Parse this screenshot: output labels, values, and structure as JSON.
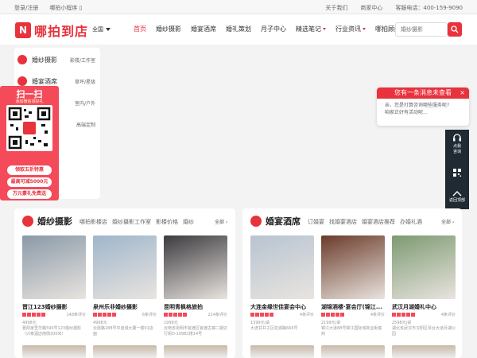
{
  "topbar": {
    "login": "登录/注册",
    "mini_program": "哪拍小程序",
    "about": "关于我们",
    "merchant": "商家中心",
    "phone": "客服电话：400-159-9090"
  },
  "header": {
    "logo_text": "哪拍到店",
    "city": "全国",
    "nav": [
      {
        "label": "首页",
        "active": true,
        "caret": false
      },
      {
        "label": "婚纱摄影",
        "active": false,
        "caret": false
      },
      {
        "label": "婚宴酒席",
        "active": false,
        "caret": false
      },
      {
        "label": "婚礼策划",
        "active": false,
        "caret": false
      },
      {
        "label": "月子中心",
        "active": false,
        "caret": false
      },
      {
        "label": "精选笔记",
        "active": false,
        "caret": true
      },
      {
        "label": "行业资讯",
        "active": false,
        "caret": true
      },
      {
        "label": "哪拍顾问",
        "active": false,
        "caret": false
      }
    ],
    "search_placeholder": "婚纱摄影"
  },
  "categories": [
    {
      "name": "婚纱摄影",
      "sub": "影楼/工作室"
    },
    {
      "name": "婚宴酒席",
      "sub": "草坪/星级"
    },
    {
      "name": "",
      "sub": "室内/户外"
    },
    {
      "name": "",
      "sub": "高端定制"
    }
  ],
  "qr_panel": {
    "title": "扫一扫",
    "subtitle": "添加微信领好礼",
    "center": "哪拍",
    "pills": [
      "领取五折特惠",
      "最高可减5000元",
      "万元豪礼免费送"
    ]
  },
  "chat": {
    "title": "您有一条消息未查看",
    "close": "×",
    "body_line1": "亲，您是打算咨询哪些服务呢?",
    "body_line2": "咱家正好有活动呢..."
  },
  "sidebar": {
    "consult_line1": "点我",
    "consult_line2": "咨询",
    "back_top": "返回顶部"
  },
  "wedding_photo": {
    "title": "婚纱摄影",
    "tags": [
      "哪拍影楼店",
      "婚纱摄影工作室",
      "影楼价格",
      "婚纱"
    ],
    "more": "全部",
    "cards": [
      {
        "name": "晋江123婚纱摄影",
        "reviews": "148条评价",
        "price": "4998元",
        "address": "晋阳家里华路590号123婚纱摄影（兴泰酒店南侧200米）",
        "color": "#8a9aa8"
      },
      {
        "name": "泉州乐非婚纱摄影",
        "reviews": "6条评价",
        "price": "4998元",
        "address": "云鼎路188号中迪城大厦一楼01店面",
        "color": "#9fb6cc"
      },
      {
        "name": "昆明青枫格旅拍",
        "reviews": "224条评价",
        "price": "1999元",
        "address": "云南省昆明市官渡区官渡古镇二期达行街D-109B1楼14号",
        "color": "#3c3a3f"
      }
    ]
  },
  "banquet": {
    "title": "婚宴酒席",
    "tags": [
      "订婚宴",
      "找婚宴酒店",
      "婚宴酒店推荐",
      "办婚礼酒"
    ],
    "more": "全部",
    "cards": [
      {
        "name": "大连金缘世佳宴会中心",
        "reviews": "4条评价",
        "price": "1399元/桌",
        "address": "大连甘井子区虹城路666号",
        "color": "#b7c4d1"
      },
      {
        "name": "湖锦酒楼·宴会厅(锦江...",
        "reviews": "4条评价",
        "price": "2199元/桌",
        "address": "锦江大道88号锦江国际城商业街底商",
        "color": "#6b3b2a"
      },
      {
        "name": "武汉月湖婚礼中心",
        "reviews": "4条评价",
        "price": "2598元/桌",
        "address": "湖北省武汉市汉阳区琴台大道月湖公园",
        "color": "#7d9a72"
      }
    ]
  }
}
